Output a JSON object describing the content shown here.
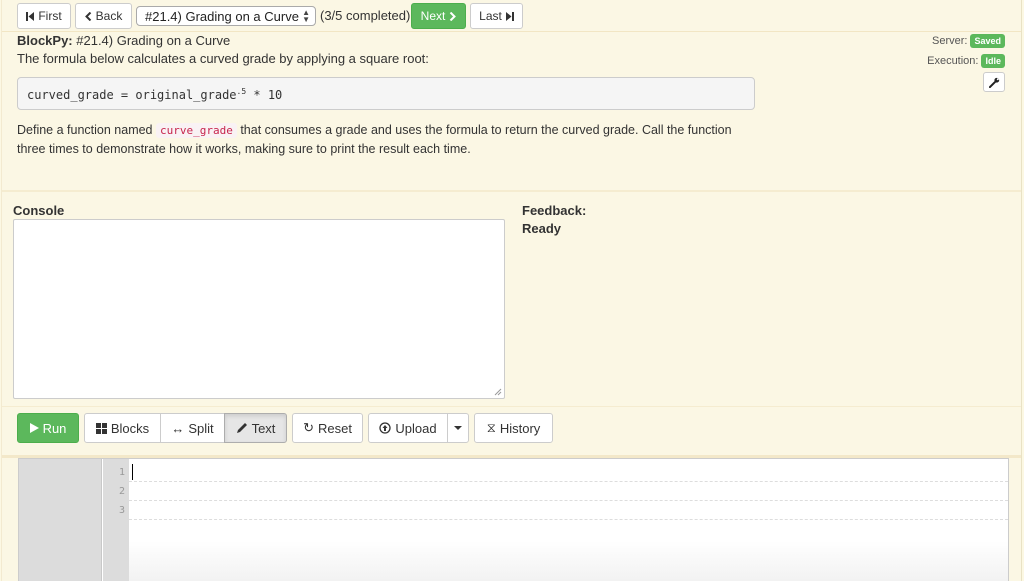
{
  "nav": {
    "first_label": "First",
    "back_label": "Back",
    "assignment_select_value": "#21.4) Grading on a Curve",
    "progress_text": "(3/5 completed)",
    "next_label": "Next",
    "last_label": "Last"
  },
  "problem": {
    "brand": "BlockPy:",
    "title": " #21.4) Grading on a Curve",
    "intro": "The formula below calculates a curved grade by applying a square root:",
    "code_before_exp": "curved_grade = original_grade",
    "code_exponent": ".5",
    "code_after_exp": " * 10",
    "desc_before": "Define a function named ",
    "desc_code": "curve_grade",
    "desc_after": " that consumes a grade and uses the formula to return the curved grade. Call the function three times to demonstrate how it works, making sure to print the result each time."
  },
  "status": {
    "server_label": "Server:",
    "server_badge": "Saved",
    "execution_label": "Execution:",
    "execution_badge": "Idle",
    "badge_color": "#5cb85c"
  },
  "console": {
    "label": "Console"
  },
  "feedback": {
    "label": "Feedback:",
    "text": "Ready"
  },
  "toolbar": {
    "run_label": "Run",
    "blocks_label": "Blocks",
    "split_label": "Split",
    "text_label": "Text",
    "reset_label": "Reset",
    "upload_label": "Upload",
    "history_label": "History",
    "active_mode": "Text"
  },
  "editor": {
    "line_numbers": [
      "1",
      "2",
      "3"
    ],
    "lines": [
      "",
      "",
      ""
    ]
  }
}
